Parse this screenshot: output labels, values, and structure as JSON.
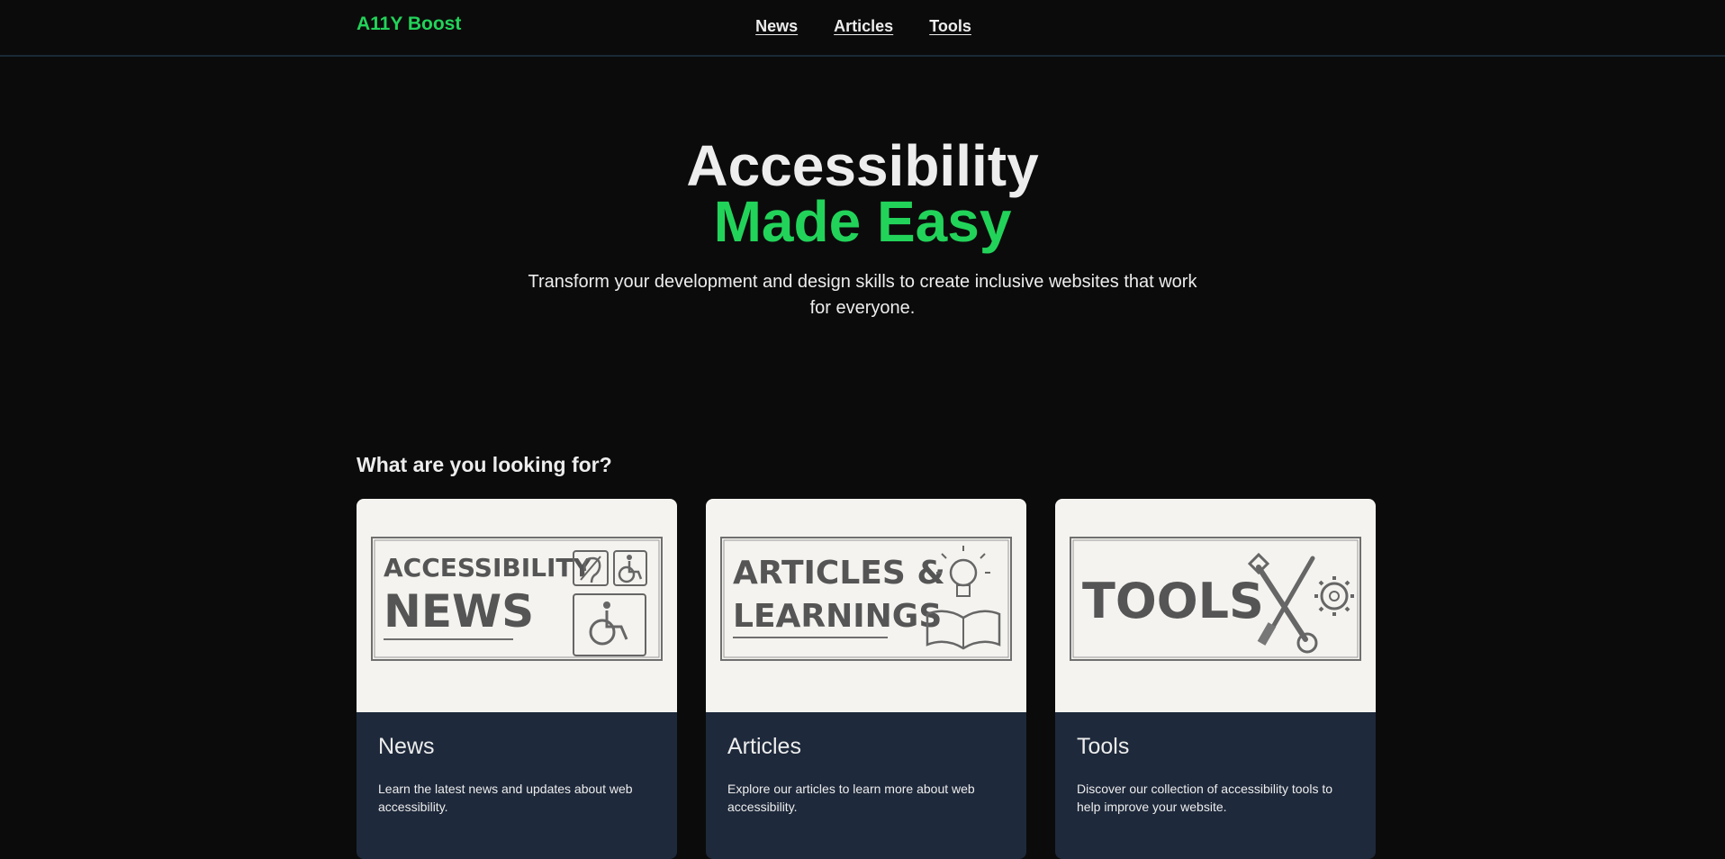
{
  "header": {
    "logo": "A11Y Boost",
    "nav": [
      {
        "label": "News"
      },
      {
        "label": "Articles"
      },
      {
        "label": "Tools"
      }
    ]
  },
  "hero": {
    "title_line1": "Accessibility",
    "title_line2": "Made Easy",
    "subtitle": "Transform your development and design skills to create inclusive websites that work for everyone."
  },
  "section": {
    "title": "What are you looking for?"
  },
  "cards": [
    {
      "title": "News",
      "description": "Learn the latest news and updates about web accessibility.",
      "image_text_1": "ACCESSIBILITY",
      "image_text_2": "NEWS"
    },
    {
      "title": "Articles",
      "description": "Explore our articles to learn more about web accessibility.",
      "image_text_1": "ARTICLES &",
      "image_text_2": "LEARNINGS"
    },
    {
      "title": "Tools",
      "description": "Discover our collection of accessibility tools to help improve your website.",
      "image_text_1": "TOOLS"
    }
  ],
  "colors": {
    "accent": "#22d35a",
    "background": "#0b0b0b",
    "card_body": "#1e293b",
    "card_image_bg": "#f4f3ef"
  }
}
